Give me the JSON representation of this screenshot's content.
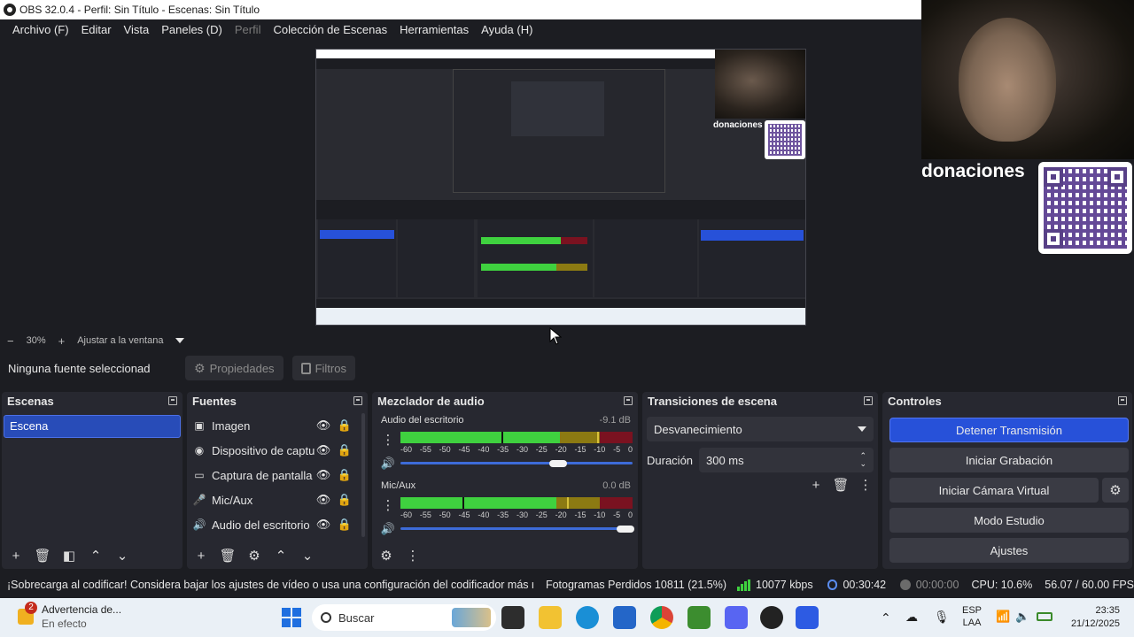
{
  "window": {
    "title": "OBS 32.0.4 - Perfil: Sin Título - Escenas: Sin Título"
  },
  "menu": [
    {
      "label": "Archivo (F)",
      "disabled": false
    },
    {
      "label": "Editar",
      "disabled": false
    },
    {
      "label": "Vista",
      "disabled": false
    },
    {
      "label": "Paneles (D)",
      "disabled": false
    },
    {
      "label": "Perfil",
      "disabled": true
    },
    {
      "label": "Colección de Escenas",
      "disabled": false
    },
    {
      "label": "Herramientas",
      "disabled": false
    },
    {
      "label": "Ayuda (H)",
      "disabled": false
    }
  ],
  "preview": {
    "zoom": "30%",
    "fit_label": "Ajustar a la ventana",
    "overlay_text": "donaciones"
  },
  "source_toolbar": {
    "no_source": "Ninguna fuente seleccionad",
    "properties": "Propiedades",
    "filters": "Filtros"
  },
  "scenes": {
    "title": "Escenas",
    "items": [
      "Escena"
    ]
  },
  "sources": {
    "title": "Fuentes",
    "items": [
      {
        "label": "Imagen",
        "icon": "image-icon"
      },
      {
        "label": "Dispositivo de captu",
        "icon": "camera-icon"
      },
      {
        "label": "Captura de pantalla",
        "icon": "monitor-icon"
      },
      {
        "label": "Mic/Aux",
        "icon": "microphone-icon"
      },
      {
        "label": "Audio del escritorio",
        "icon": "speaker-icon"
      }
    ]
  },
  "mixer": {
    "title": "Mezclador de audio",
    "scale": [
      "-60",
      "-55",
      "-50",
      "-45",
      "-40",
      "-35",
      "-30",
      "-25",
      "-20",
      "-15",
      "-10",
      "-5",
      "0"
    ],
    "channels": [
      {
        "name": "Audio del escritorio",
        "db": "-9.1 dB",
        "level": 0.85,
        "volume": 0.72
      },
      {
        "name": "Mic/Aux",
        "db": "0.0 dB",
        "level": 0.7,
        "volume": 0.97
      }
    ]
  },
  "transitions": {
    "title": "Transiciones de escena",
    "selected": "Desvanecimiento",
    "duration_label": "Duración",
    "duration_value": "300 ms"
  },
  "controls": {
    "title": "Controles",
    "buttons": [
      "Detener Transmisión",
      "Iniciar Grabación",
      "Iniciar Cámara Virtual",
      "Modo Estudio",
      "Ajustes"
    ]
  },
  "status": {
    "warning": "¡Sobrecarga al codificar! Considera bajar los ajustes de vídeo o usa una configuración del codificador más rápi",
    "dropped": "Fotogramas Perdidos 10811 (21.5%)",
    "bitrate": "10077 kbps",
    "stream_time": "00:30:42",
    "rec_time": "00:00:00",
    "cpu": "CPU: 10.6%",
    "fps": "56.07 / 60.00 FPS"
  },
  "taskbar": {
    "notification_title": "Advertencia de...",
    "notification_sub": "En efecto",
    "notification_count": "2",
    "search": "Buscar",
    "lang_top": "ESP",
    "lang_bottom": "LAA",
    "time": "23:35",
    "date": "21/12/2025"
  },
  "colors": {
    "accent": "#2751d9",
    "meter_green": "#3fd13f",
    "meter_yellow": "#8c7a12",
    "meter_red": "#7a1220"
  }
}
